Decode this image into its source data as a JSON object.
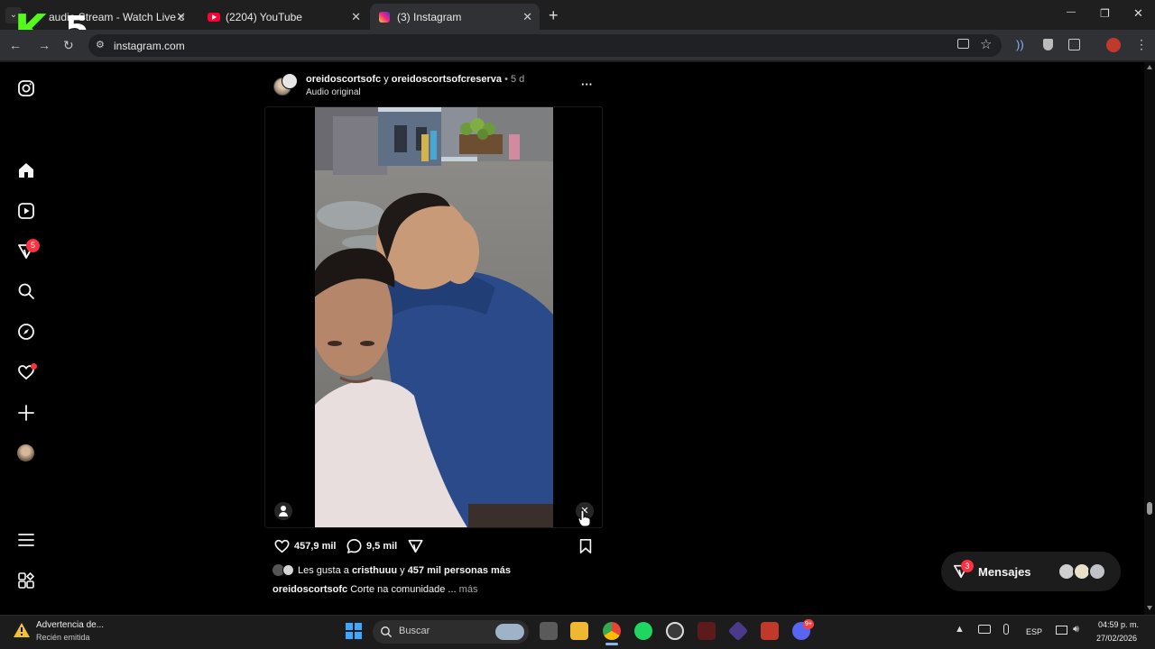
{
  "browser": {
    "tabs": [
      {
        "label": "audio Stream - Watch Live c",
        "close": "✕"
      },
      {
        "label": "(2204) YouTube",
        "close": "✕"
      },
      {
        "label": "(3) Instagram",
        "close": "✕"
      }
    ],
    "new_tab": "+",
    "url": "instagram.com",
    "window": {
      "minimize": "—",
      "maximize": "❐",
      "close": "✕"
    }
  },
  "overlay_logo": {
    "letter": "K",
    "number": "5"
  },
  "sidebar": {
    "notification_badge": "5"
  },
  "post": {
    "author_line_user1": "oreidoscortsofc",
    "author_line_and": " y ",
    "author_line_user2": "oreidoscortsofcreserva",
    "author_line_time": " • 5 d",
    "audio": "Audio original",
    "more": "···",
    "likes": "457,9 mil",
    "comments": "9,5 mil",
    "liked_by_prefix": "Les gusta a ",
    "liked_by_user": "cristhuuu",
    "liked_by_mid": " y ",
    "liked_by_count": "457 mil personas más",
    "caption_user": "oreidoscortsofc",
    "caption_text": " Corte na comunidade ...",
    "caption_more": " más"
  },
  "messages": {
    "label": "Mensajes",
    "badge": "3"
  },
  "taskbar": {
    "notification_title": "Advertencia de...",
    "notification_sub": "Recién emitida",
    "search_placeholder": "Buscar",
    "discord_badge": "9+",
    "lang": "ESP",
    "time": "04:59 p. m.",
    "date": "27/02/2026"
  },
  "colors": {
    "ig_badge": "#ff3040",
    "chrome_bg": "#1f1f1f",
    "toolbar_bg": "#303134",
    "accent": "#8ab4f8"
  }
}
